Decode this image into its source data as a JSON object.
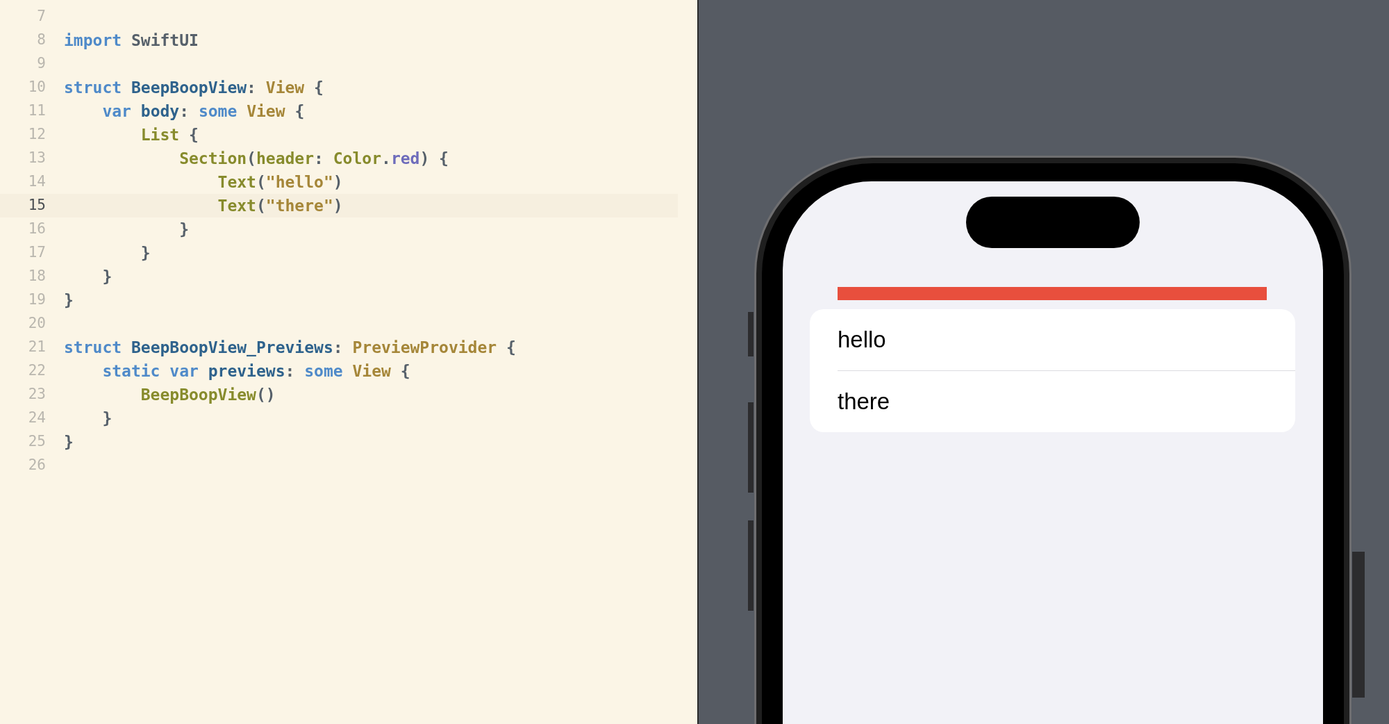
{
  "editor": {
    "lines": [
      {
        "number": "7",
        "current": false
      },
      {
        "number": "8",
        "current": false,
        "tokens": [
          {
            "text": "import",
            "kind": "keyword"
          },
          {
            "text": " SwiftUI",
            "kind": "plain"
          }
        ]
      },
      {
        "number": "9",
        "current": false
      },
      {
        "number": "10",
        "current": false,
        "tokens": [
          {
            "text": "struct",
            "kind": "keyword"
          },
          {
            "text": " BeepBoopView",
            "kind": "decl"
          },
          {
            "text": ": ",
            "kind": "punct"
          },
          {
            "text": "View",
            "kind": "type"
          },
          {
            "text": " {",
            "kind": "punct"
          }
        ]
      },
      {
        "number": "11",
        "current": false,
        "tokens": [
          {
            "text": "    var",
            "kind": "keyword"
          },
          {
            "text": " body",
            "kind": "decl"
          },
          {
            "text": ": ",
            "kind": "punct"
          },
          {
            "text": "some",
            "kind": "keyword"
          },
          {
            "text": " View",
            "kind": "type"
          },
          {
            "text": " {",
            "kind": "punct"
          }
        ]
      },
      {
        "number": "12",
        "current": false,
        "tokens": [
          {
            "text": "        List",
            "kind": "func"
          },
          {
            "text": " {",
            "kind": "punct"
          }
        ]
      },
      {
        "number": "13",
        "current": false,
        "tokens": [
          {
            "text": "            Section",
            "kind": "func"
          },
          {
            "text": "(",
            "kind": "punct"
          },
          {
            "text": "header",
            "kind": "func"
          },
          {
            "text": ": ",
            "kind": "punct"
          },
          {
            "text": "Color",
            "kind": "func"
          },
          {
            "text": ".",
            "kind": "punct"
          },
          {
            "text": "red",
            "kind": "member"
          },
          {
            "text": ") {",
            "kind": "punct"
          }
        ]
      },
      {
        "number": "14",
        "current": false,
        "tokens": [
          {
            "text": "                Text",
            "kind": "func"
          },
          {
            "text": "(",
            "kind": "punct"
          },
          {
            "text": "\"hello\"",
            "kind": "string"
          },
          {
            "text": ")",
            "kind": "punct"
          }
        ]
      },
      {
        "number": "15",
        "current": true,
        "tokens": [
          {
            "text": "                Text",
            "kind": "func"
          },
          {
            "text": "(",
            "kind": "punct"
          },
          {
            "text": "\"there\"",
            "kind": "string"
          },
          {
            "text": ")",
            "kind": "punct"
          }
        ]
      },
      {
        "number": "16",
        "current": false,
        "tokens": [
          {
            "text": "            }",
            "kind": "punct"
          }
        ]
      },
      {
        "number": "17",
        "current": false,
        "tokens": [
          {
            "text": "        }",
            "kind": "punct"
          }
        ]
      },
      {
        "number": "18",
        "current": false,
        "tokens": [
          {
            "text": "    }",
            "kind": "punct"
          }
        ]
      },
      {
        "number": "19",
        "current": false,
        "tokens": [
          {
            "text": "}",
            "kind": "punct"
          }
        ]
      },
      {
        "number": "20",
        "current": false
      },
      {
        "number": "21",
        "current": false,
        "tokens": [
          {
            "text": "struct",
            "kind": "keyword"
          },
          {
            "text": " BeepBoopView_Previews",
            "kind": "decl"
          },
          {
            "text": ": ",
            "kind": "punct"
          },
          {
            "text": "PreviewProvider",
            "kind": "type"
          },
          {
            "text": " {",
            "kind": "punct"
          }
        ]
      },
      {
        "number": "22",
        "current": false,
        "tokens": [
          {
            "text": "    static var",
            "kind": "keyword"
          },
          {
            "text": " previews",
            "kind": "decl"
          },
          {
            "text": ": ",
            "kind": "punct"
          },
          {
            "text": "some",
            "kind": "keyword"
          },
          {
            "text": " View",
            "kind": "type"
          },
          {
            "text": " {",
            "kind": "punct"
          }
        ]
      },
      {
        "number": "23",
        "current": false,
        "tokens": [
          {
            "text": "        BeepBoopView",
            "kind": "func"
          },
          {
            "text": "()",
            "kind": "punct"
          }
        ]
      },
      {
        "number": "24",
        "current": false,
        "tokens": [
          {
            "text": "    }",
            "kind": "punct"
          }
        ]
      },
      {
        "number": "25",
        "current": false,
        "tokens": [
          {
            "text": "}",
            "kind": "punct"
          }
        ]
      },
      {
        "number": "26",
        "current": false
      }
    ]
  },
  "preview": {
    "rows": [
      "hello",
      "there"
    ]
  }
}
